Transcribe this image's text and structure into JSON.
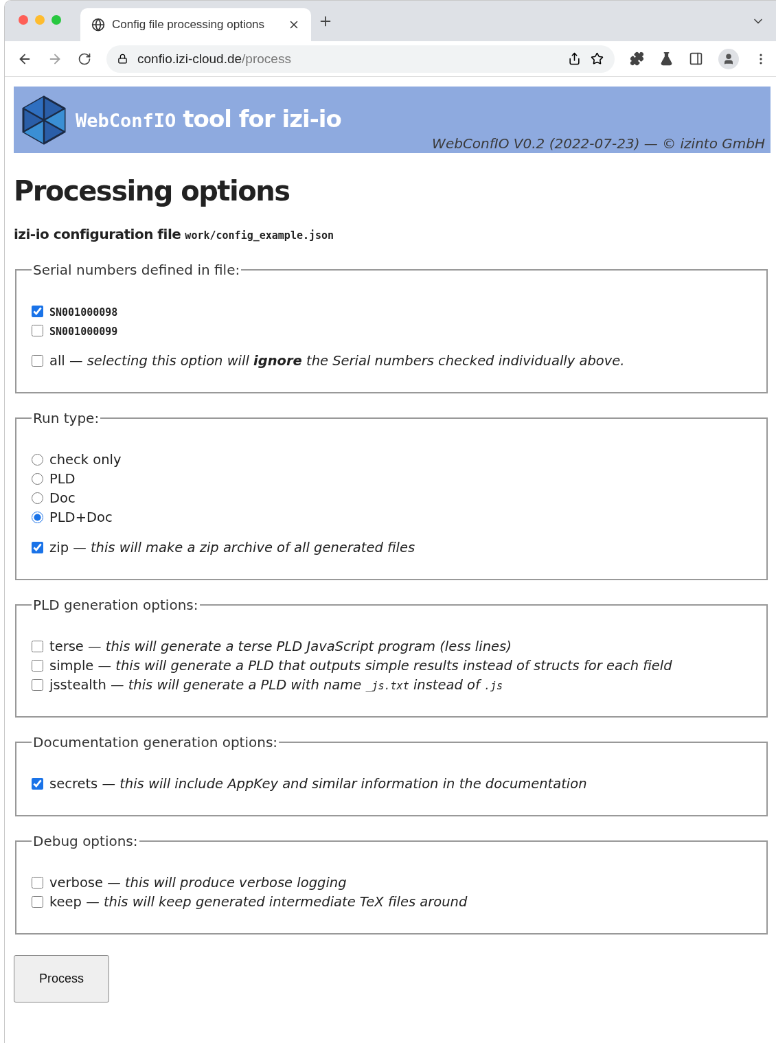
{
  "browser": {
    "tab_title": "Config file processing options",
    "url_host": "confio.izi-cloud.de",
    "url_path": "/process"
  },
  "banner": {
    "brand_mono": "WebConfIO",
    "brand_rest": "tool for izi-io",
    "version": "WebConfIO V0.2 (2022-07-23) — © izinto GmbH"
  },
  "heading": "Processing options",
  "config_file": {
    "label": "izi-io configuration file",
    "path": "work/config_example.json"
  },
  "fieldsets": [
    {
      "legend": "Serial numbers defined in file:",
      "groups": [
        [
          {
            "kind": "checkbox",
            "name": "SN001000098",
            "code": true,
            "checked": true
          },
          {
            "kind": "checkbox",
            "name": "SN001000099",
            "code": true,
            "checked": false
          }
        ],
        [
          {
            "kind": "checkbox",
            "name": "all",
            "code": false,
            "checked": false,
            "description": [
              {
                "kind": "prose",
                "text": "— selecting this option will **ignore** the Serial numbers checked individually above."
              }
            ]
          }
        ]
      ]
    },
    {
      "legend": "Run type:",
      "groups": [
        [
          {
            "kind": "radio",
            "name": "check only",
            "code": false,
            "selected": false
          },
          {
            "kind": "radio",
            "name": "PLD",
            "code": false,
            "selected": false
          },
          {
            "kind": "radio",
            "name": "Doc",
            "code": false,
            "selected": false
          },
          {
            "kind": "radio",
            "name": "PLD+Doc",
            "code": false,
            "selected": true
          }
        ],
        [
          {
            "kind": "checkbox",
            "name": "zip",
            "code": false,
            "checked": true,
            "description": [
              {
                "kind": "prose",
                "text": "— this will make a zip archive of all generated files"
              }
            ]
          }
        ]
      ]
    },
    {
      "legend": "PLD generation options:",
      "groups": [
        [
          {
            "kind": "checkbox",
            "name": "terse",
            "code": false,
            "checked": false,
            "description": [
              {
                "kind": "prose",
                "text": "— this will generate a terse PLD JavaScript program (less lines)"
              }
            ]
          },
          {
            "kind": "checkbox",
            "name": "simple",
            "code": false,
            "checked": false,
            "description": [
              {
                "kind": "prose",
                "text": "— this will generate a PLD that outputs simple results instead of structs for each field"
              }
            ]
          },
          {
            "kind": "checkbox",
            "name": "jsstealth",
            "code": false,
            "checked": false,
            "description": [
              {
                "kind": "prose",
                "text": "— this will generate a PLD with name"
              },
              {
                "kind": "code",
                "text": "_js.txt"
              },
              {
                "kind": "prose",
                "text": "instead of"
              },
              {
                "kind": "code",
                "text": ".js"
              }
            ]
          }
        ]
      ]
    },
    {
      "legend": "Documentation generation options:",
      "groups": [
        [
          {
            "kind": "checkbox",
            "name": "secrets",
            "code": false,
            "checked": true,
            "description": [
              {
                "kind": "prose",
                "text": "— this will include AppKey and similar information in the documentation"
              }
            ]
          }
        ]
      ]
    },
    {
      "legend": "Debug options:",
      "groups": [
        [
          {
            "kind": "checkbox",
            "name": "verbose",
            "code": false,
            "checked": false,
            "description": [
              {
                "kind": "prose",
                "text": "— this will produce verbose logging"
              }
            ]
          },
          {
            "kind": "checkbox",
            "name": "keep",
            "code": false,
            "checked": false,
            "description": [
              {
                "kind": "prose",
                "text": "— this will keep generated intermediate TeX files around"
              }
            ]
          }
        ]
      ]
    }
  ],
  "submit": "Process"
}
